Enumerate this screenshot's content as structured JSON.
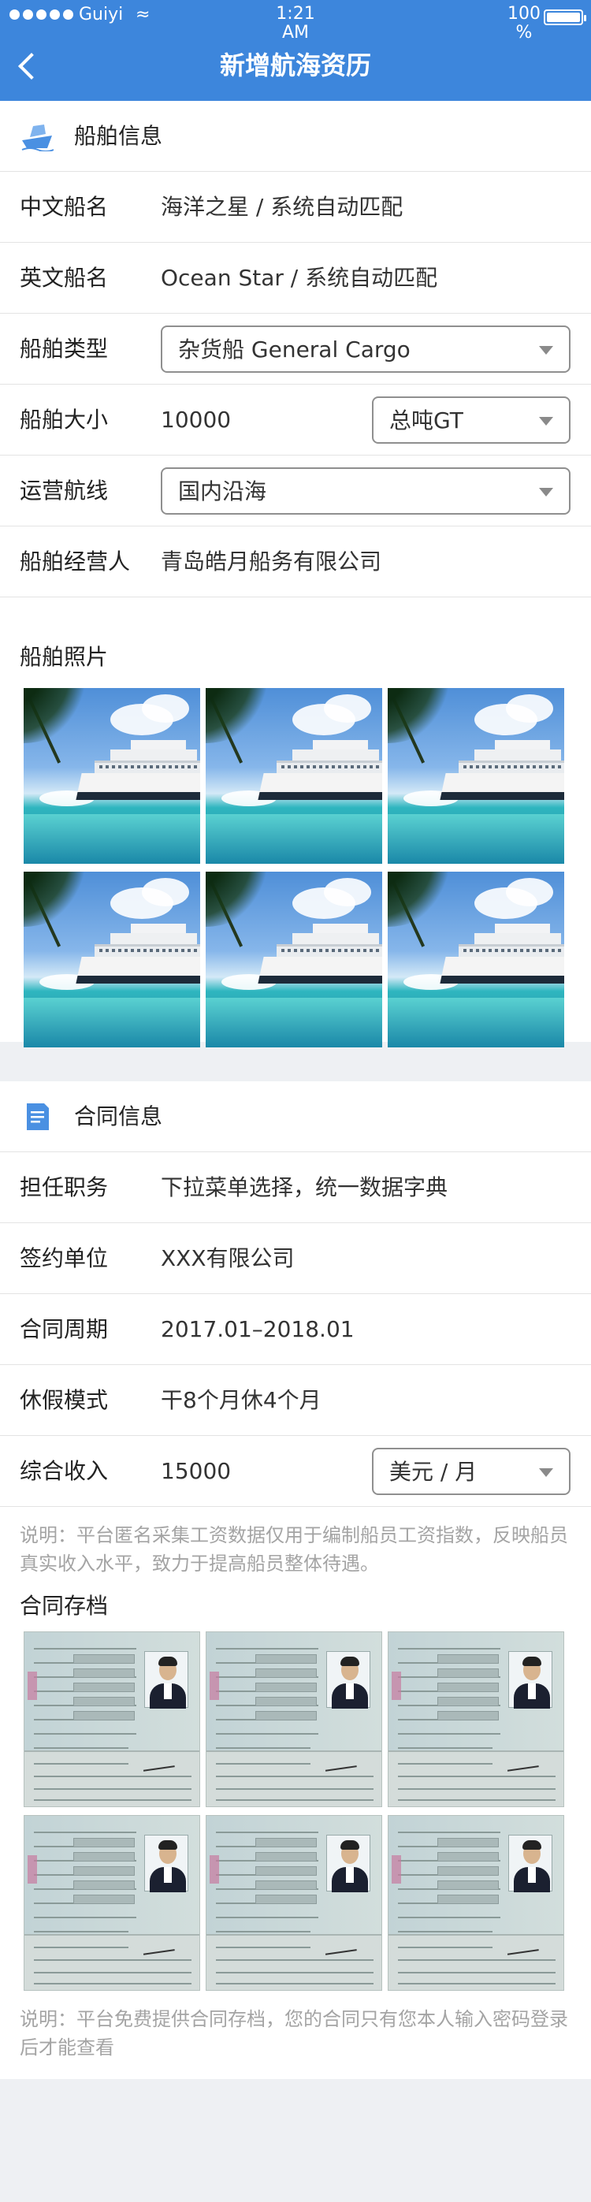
{
  "status_bar": {
    "carrier": "Guiyi",
    "time": "1:21 AM",
    "battery": "100 %"
  },
  "header": {
    "title": "新增航海资历"
  },
  "ship_section": {
    "title": "船舶信息",
    "rows": [
      {
        "label": "中文船名",
        "value": "海洋之星 / 系统自动匹配"
      },
      {
        "label": "英文船名",
        "value": "Ocean Star / 系统自动匹配"
      },
      {
        "label": "船舶类型",
        "select": "杂货船 General Cargo"
      },
      {
        "label": "船舶大小",
        "value": "10000",
        "select": "总吨GT"
      },
      {
        "label": "运营航线",
        "select": "国内沿海"
      },
      {
        "label": "船舶经营人",
        "value": "青岛皓月船务有限公司"
      }
    ],
    "photos_label": "船舶照片",
    "photo_count": 6
  },
  "contract_section": {
    "title": "合同信息",
    "rows": [
      {
        "label": "担任职务",
        "value": "下拉菜单选择，统一数据字典"
      },
      {
        "label": "签约单位",
        "value": "XXX有限公司"
      },
      {
        "label": "合同周期",
        "value": "2017.01–2018.01"
      },
      {
        "label": "休假模式",
        "value": "干8个月休4个月"
      },
      {
        "label": "综合收入",
        "value": "15000",
        "select": "美元 / 月"
      }
    ],
    "income_note": "说明：平台匿名采集工资数据仅用于编制船员工资指数，反映船员真实收入水平，致力于提高船员整体待遇。",
    "archive_label": "合同存档",
    "archive_count": 6,
    "archive_note": "说明：平台免费提供合同存档，您的合同只有您本人输入密码登录后才能查看"
  },
  "colors": {
    "header": "#3d86dc",
    "background": "#eef0f3"
  }
}
